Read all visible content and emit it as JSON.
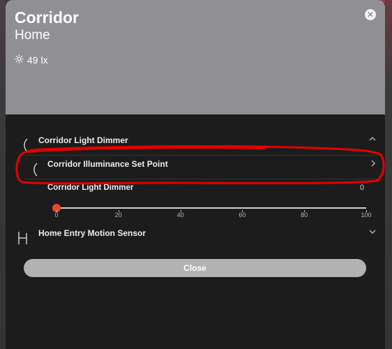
{
  "header": {
    "title": "Corridor",
    "subtitle": "Home",
    "illuminance": "49 lx",
    "icons": {
      "illuminance": "sun-icon",
      "close": "close-circle-icon"
    }
  },
  "group": {
    "title": "Corridor Light Dimmer",
    "expanded": true
  },
  "setpoint_row": {
    "title": "Corridor Illuminance Set Point"
  },
  "dimmer": {
    "label": "Corridor Light Dimmer",
    "value": "0",
    "slider_value": 0,
    "slider_min": 0,
    "slider_max": 100,
    "ticks": [
      "0",
      "20",
      "40",
      "60",
      "80",
      "100"
    ]
  },
  "motion_sensor": {
    "title": "Home Entry Motion Sensor",
    "expanded": false
  },
  "footer": {
    "close_label": "Close"
  },
  "colors": {
    "header_bg": "#909094",
    "dialog_bg": "#1c1c1c",
    "slider_thumb": "#e84a2f",
    "annotation": "#e60000",
    "close_button": "#b2b2b2"
  }
}
